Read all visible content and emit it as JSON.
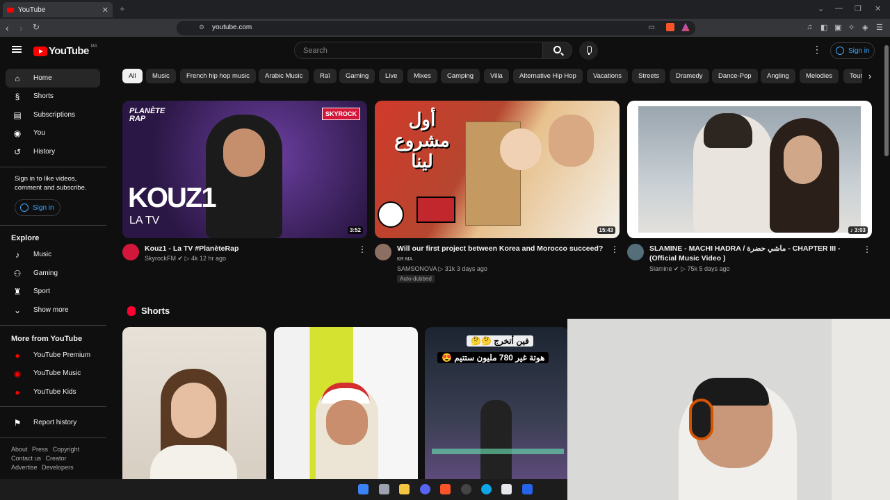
{
  "browser": {
    "tab_title": "YouTube",
    "new_tab": "+",
    "url": "youtube.com"
  },
  "header": {
    "logo_text": "YouTube",
    "country_code": "MA",
    "search_placeholder": "Search",
    "more_icon": "⋮",
    "signin_label": "Sign in"
  },
  "sidebar": {
    "main_items": [
      {
        "label": "Home",
        "icon": "home-icon",
        "active": true
      },
      {
        "label": "Shorts",
        "icon": "shorts-icon"
      },
      {
        "label": "Subscriptions",
        "icon": "subscriptions-icon"
      },
      {
        "label": "You",
        "icon": "you-icon"
      },
      {
        "label": "History",
        "icon": "history-icon"
      }
    ],
    "signin_prompt": "Sign in to like videos, comment and subscribe.",
    "signin_label": "Sign in",
    "explore_title": "Explore",
    "explore_items": [
      {
        "label": "Music",
        "icon": "music-icon"
      },
      {
        "label": "Gaming",
        "icon": "gaming-icon"
      },
      {
        "label": "Sport",
        "icon": "trophy-icon"
      },
      {
        "label": "Show more",
        "icon": "chevron-down-icon"
      }
    ],
    "more_title": "More from YouTube",
    "more_items": [
      {
        "label": "YouTube Premium"
      },
      {
        "label": "YouTube Music"
      },
      {
        "label": "YouTube Kids"
      }
    ],
    "report_history": "Report history",
    "footer_row1": [
      "About",
      "Press",
      "Copyright"
    ],
    "footer_row2": [
      "Contact us",
      "Creator"
    ],
    "footer_row3": [
      "Advertise",
      "Developers"
    ]
  },
  "chips": [
    "All",
    "Music",
    "French hip hop music",
    "Arabic Music",
    "Raï",
    "Gaming",
    "Live",
    "Mixes",
    "Camping",
    "Villa",
    "Alternative Hip Hop",
    "Vacations",
    "Streets",
    "Dramedy",
    "Dance-Pop",
    "Angling",
    "Melodies",
    "Tour"
  ],
  "videos": [
    {
      "title": "Kouz1 - La TV #PlanèteRap",
      "channel": "SkyrockFM",
      "verified": true,
      "views": "4k",
      "age": "12 hr ago",
      "duration": "3:52",
      "thumb_text_main": "KOUZ1",
      "thumb_text_sub": "LA TV",
      "thumb_brand": "PLANÈTE RAP",
      "thumb_logo": "SKYROCK",
      "color": "#3a1f5c"
    },
    {
      "title": "Will our first project between Korea and Morocco succeed?",
      "title_tag": "KR MA",
      "channel": "SAMSONOVA",
      "views": "31k",
      "age": "3 days ago",
      "duration": "15:43",
      "badge": "Auto-dubbed",
      "thumb_arabic": "أول مشروع لينا",
      "color": "#c8102e"
    },
    {
      "title": "SLAMINE - MACHI HADRA / ماشي حضرة - CHAPTER III - (Official Music Video )",
      "channel": "Slamine",
      "verified": true,
      "views": "75k",
      "age": "5 days ago",
      "duration": "3:03",
      "color": "#b7c1c9"
    }
  ],
  "shorts": {
    "title": "Shorts",
    "items": [
      {
        "overlay": ""
      },
      {
        "overlay": ""
      },
      {
        "overlay_line1": "فين أتخرج 🤔🤔",
        "overlay_line2": "هوتة غير 780 مليون ستتيم 😍"
      }
    ]
  },
  "view_sep": "·"
}
